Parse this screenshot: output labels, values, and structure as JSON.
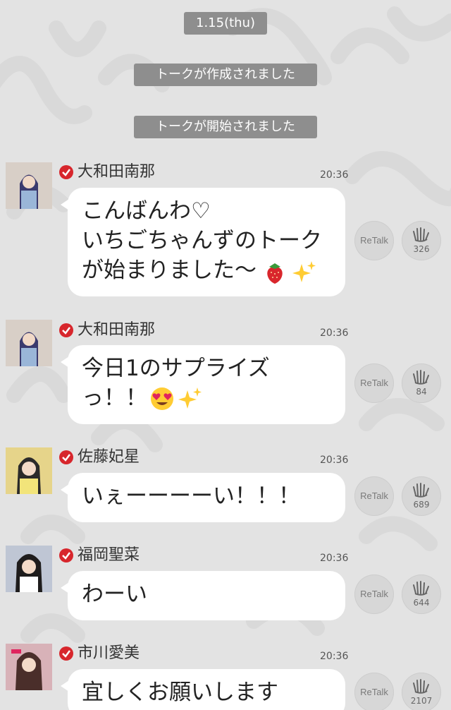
{
  "date_label": "1.15(thu)",
  "system_messages": [
    "トークが作成されました",
    "トークが開始されました"
  ],
  "retalk_label": "ReTalk",
  "messages": [
    {
      "name": "大和田南那",
      "time": "20:36",
      "text": "こんばんわ♡\nいちごちゃんずのトーク\nが始まりました〜",
      "emojis": [
        "strawberry",
        "sparkles"
      ],
      "clap_count": "326"
    },
    {
      "name": "大和田南那",
      "time": "20:36",
      "text": "今日1のサプライズ\nっ！！",
      "emojis": [
        "heart-eyes",
        "sparkles"
      ],
      "clap_count": "84"
    },
    {
      "name": "佐藤妃星",
      "time": "20:36",
      "text": "いぇーーーーい！！！",
      "emojis": [],
      "clap_count": "689"
    },
    {
      "name": "福岡聖菜",
      "time": "20:36",
      "text": "わーい",
      "emojis": [],
      "clap_count": "644"
    },
    {
      "name": "市川愛美",
      "time": "20:36",
      "text": "宜しくお願いします(^^♪",
      "emojis": [],
      "clap_count": "2107"
    }
  ],
  "colors": {
    "background": "#e3e3e3",
    "verified_badge": "#d7262c",
    "pill": "#8e8e8e",
    "bubble": "#ffffff"
  }
}
